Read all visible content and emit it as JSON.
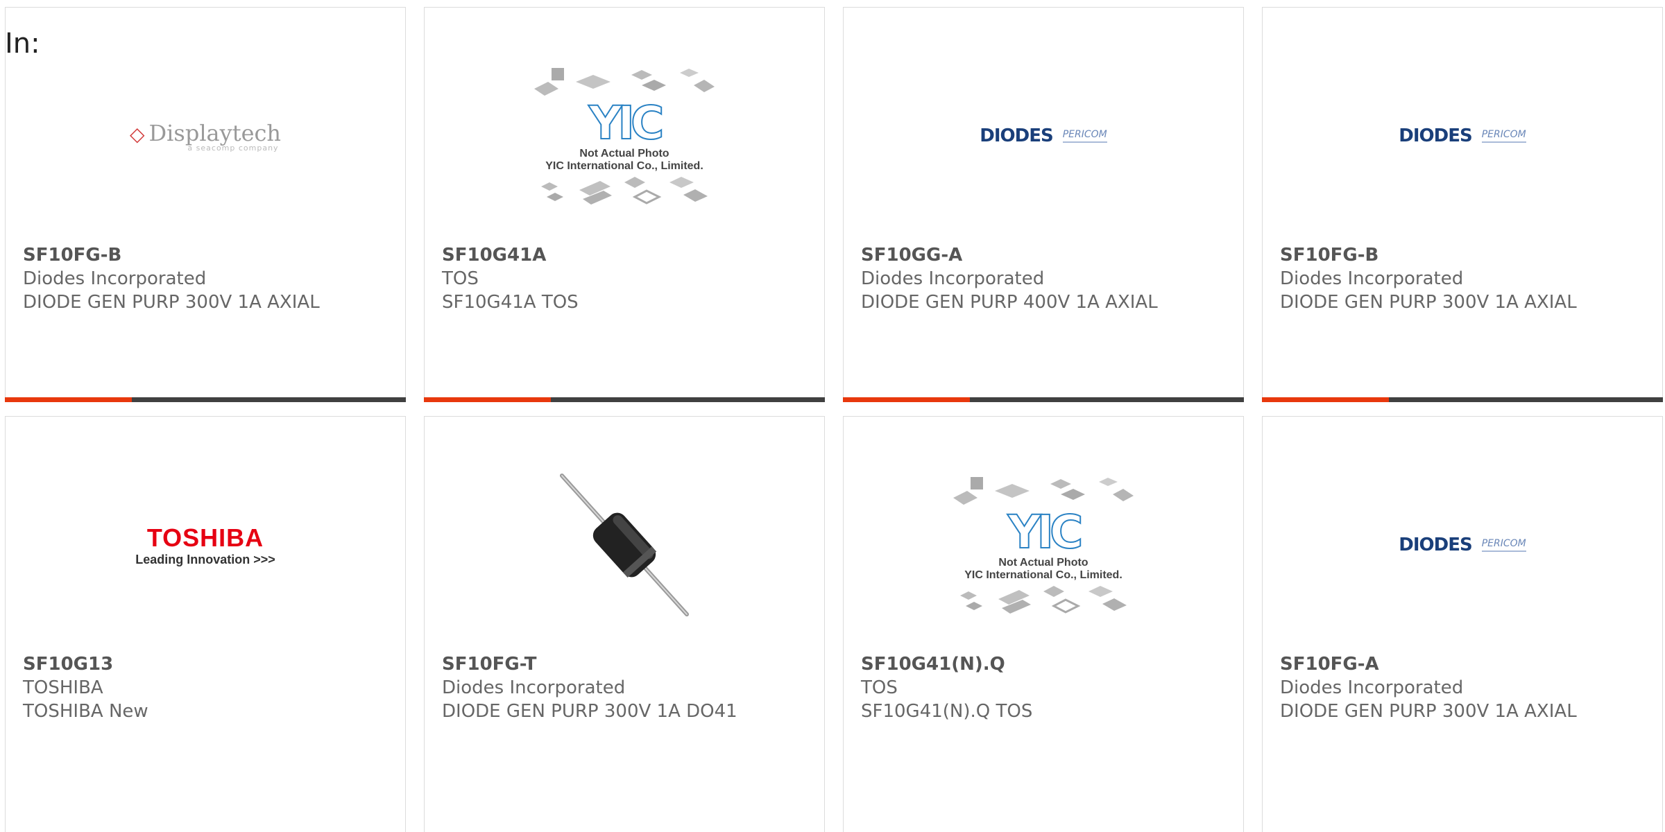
{
  "header": {
    "in_label": "In:"
  },
  "colors": {
    "accent": "#e8380d",
    "bar": "#404040",
    "diodes_blue": "#1a3f7a",
    "toshiba_red": "#e60012"
  },
  "products": [
    {
      "part_number": "SF10FG-B",
      "manufacturer": "Diodes Incorporated",
      "description": "DIODE GEN PURP 300V 1A AXIAL",
      "logo": {
        "type": "displaytech",
        "name": "Displaytech",
        "tagline": "a seacomp company"
      }
    },
    {
      "part_number": "SF10G41A",
      "manufacturer": "TOS",
      "description": "SF10G41A TOS",
      "logo": {
        "type": "yic",
        "mark": "YIC",
        "line1": "Not Actual Photo",
        "line2": "YIC International Co., Limited."
      }
    },
    {
      "part_number": "SF10GG-A",
      "manufacturer": "Diodes Incorporated",
      "description": "DIODE GEN PURP 400V 1A AXIAL",
      "logo": {
        "type": "diodes",
        "name": "DIODES",
        "partner": "PERICOM"
      }
    },
    {
      "part_number": "SF10FG-B",
      "manufacturer": "Diodes Incorporated",
      "description": "DIODE GEN PURP 300V 1A AXIAL",
      "logo": {
        "type": "diodes",
        "name": "DIODES",
        "partner": "PERICOM"
      }
    },
    {
      "part_number": "SF10G13",
      "manufacturer": "TOSHIBA",
      "description": "TOSHIBA New",
      "logo": {
        "type": "toshiba",
        "name": "TOSHIBA",
        "tagline": "Leading Innovation >>>"
      }
    },
    {
      "part_number": "SF10FG-T",
      "manufacturer": "Diodes Incorporated",
      "description": "DIODE GEN PURP 300V 1A DO41",
      "logo": {
        "type": "diode-photo",
        "icon": "axial-diode-icon"
      }
    },
    {
      "part_number": "SF10G41(N).Q",
      "manufacturer": "TOS",
      "description": "SF10G41(N).Q TOS",
      "logo": {
        "type": "yic",
        "mark": "YIC",
        "line1": "Not Actual Photo",
        "line2": "YIC International Co., Limited."
      }
    },
    {
      "part_number": "SF10FG-A",
      "manufacturer": "Diodes Incorporated",
      "description": "DIODE GEN PURP 300V 1A AXIAL",
      "logo": {
        "type": "diodes",
        "name": "DIODES",
        "partner": "PERICOM"
      }
    }
  ]
}
